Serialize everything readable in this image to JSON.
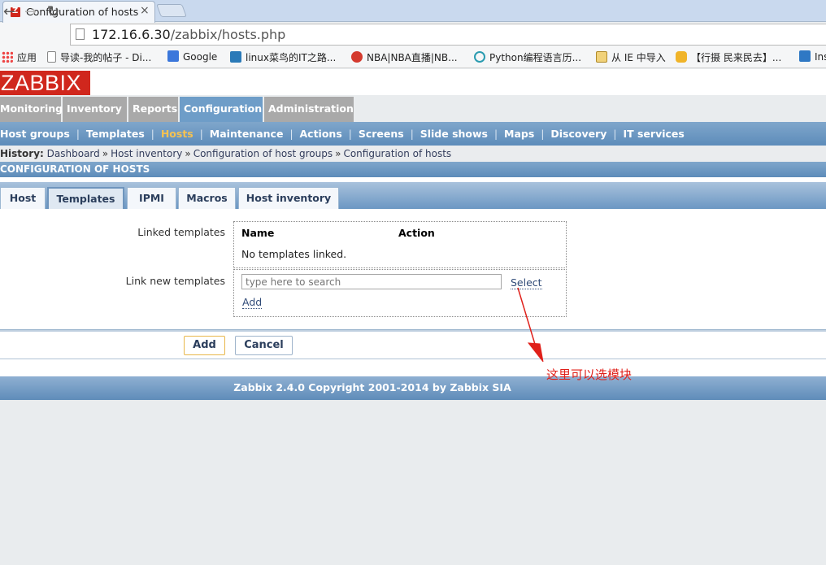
{
  "browser": {
    "tab_title": "Configuration of hosts",
    "close_glyph": "×",
    "url_host": "172.16.6.30",
    "url_path": "/zabbix/hosts.php",
    "back_glyph": "←",
    "forward_glyph": "→",
    "reload_glyph": "↻",
    "bookmarks": [
      {
        "label": "应用",
        "icon": "apps-icon"
      },
      {
        "label": "导读-我的帖子 - Di...",
        "icon": "page-icon"
      },
      {
        "label": "Google",
        "icon": "google-icon"
      },
      {
        "label": "linux菜鸟的IT之路...",
        "icon": "blog-icon"
      },
      {
        "label": "NBA|NBA直播|NB...",
        "icon": "weibo-icon"
      },
      {
        "label": "Python编程语言历...",
        "icon": "play-icon"
      },
      {
        "label": "从 IE 中导入",
        "icon": "folder-icon"
      },
      {
        "label": "【行摄 民来民去】...",
        "icon": "hand-icon"
      },
      {
        "label": "Ins",
        "icon": "home-icon"
      }
    ]
  },
  "app": {
    "logo": "ZABBIX",
    "main_menu": [
      "Monitoring",
      "Inventory",
      "Reports",
      "Configuration",
      "Administration"
    ],
    "main_menu_active": "Configuration",
    "sub_menu": [
      "Host groups",
      "Templates",
      "Hosts",
      "Maintenance",
      "Actions",
      "Screens",
      "Slide shows",
      "Maps",
      "Discovery",
      "IT services"
    ],
    "sub_menu_active": "Hosts",
    "history_label": "History:",
    "history": [
      "Dashboard",
      "Host inventory",
      "Configuration of host groups",
      "Configuration of hosts"
    ],
    "history_sep": "»",
    "page_title": "CONFIGURATION OF HOSTS",
    "form_tabs": [
      "Host",
      "Templates",
      "IPMI",
      "Macros",
      "Host inventory"
    ],
    "form_tabs_active": "Templates",
    "linked_templates_label": "Linked templates",
    "col_name": "Name",
    "col_action": "Action",
    "no_templates": "No templates linked.",
    "link_new_label": "Link new templates",
    "search_placeholder": "type here to search",
    "select_link": "Select",
    "add_link": "Add",
    "add_button": "Add",
    "cancel_button": "Cancel",
    "footer": "Zabbix 2.4.0 Copyright 2001-2014 by Zabbix SIA"
  },
  "annotation": {
    "text": "这里可以选模块",
    "color": "#e0201a"
  },
  "colors": {
    "brand": "#d0271d",
    "menu_active": "#6e9dc8",
    "submenu_active_text": "#f5c251"
  }
}
